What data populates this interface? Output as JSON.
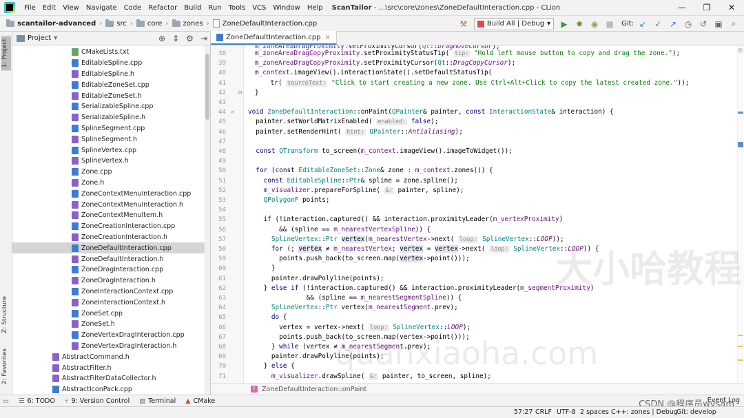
{
  "menubar": {
    "items": [
      "File",
      "Edit",
      "View",
      "Navigate",
      "Code",
      "Refactor",
      "Build",
      "Run",
      "Tools",
      "VCS",
      "Window",
      "Help"
    ],
    "title_app": "ScanTailor",
    "title_path": " - ...\\src\\core\\zones\\ZoneDefaultInteraction.cpp - CLion",
    "min": "—",
    "max": "❐",
    "close": "✕"
  },
  "navbar": {
    "crumbs": [
      "scantailor-advanced",
      "src",
      "core",
      "zones",
      "ZoneDefaultInteraction.cpp"
    ],
    "run_config": "Build All | Debug",
    "git_label": "Git:"
  },
  "left_stripe": {
    "project_tab": "1: Project",
    "structure_tab": "Z: Structure",
    "favorites_tab": "2: Favorites"
  },
  "project_panel": {
    "title": "Project",
    "files": [
      {
        "name": "CMakeLists.txt",
        "type": "txt",
        "indent": 3
      },
      {
        "name": "EditableSpline.cpp",
        "type": "cpp",
        "indent": 3
      },
      {
        "name": "EditableSpline.h",
        "type": "h",
        "indent": 3
      },
      {
        "name": "EditableZoneSet.cpp",
        "type": "cpp",
        "indent": 3
      },
      {
        "name": "EditableZoneSet.h",
        "type": "h",
        "indent": 3
      },
      {
        "name": "SerializableSpline.cpp",
        "type": "cpp",
        "indent": 3
      },
      {
        "name": "SerializableSpline.h",
        "type": "h",
        "indent": 3
      },
      {
        "name": "SplineSegment.cpp",
        "type": "cpp",
        "indent": 3
      },
      {
        "name": "SplineSegment.h",
        "type": "h",
        "indent": 3
      },
      {
        "name": "SplineVertex.cpp",
        "type": "cpp",
        "indent": 3
      },
      {
        "name": "SplineVertex.h",
        "type": "h",
        "indent": 3
      },
      {
        "name": "Zone.cpp",
        "type": "cpp",
        "indent": 3
      },
      {
        "name": "Zone.h",
        "type": "h",
        "indent": 3
      },
      {
        "name": "ZoneContextMenuInteraction.cpp",
        "type": "cpp",
        "indent": 3
      },
      {
        "name": "ZoneContextMenuInteraction.h",
        "type": "h",
        "indent": 3
      },
      {
        "name": "ZoneContextMenuItem.h",
        "type": "h",
        "indent": 3
      },
      {
        "name": "ZoneCreationInteraction.cpp",
        "type": "cpp",
        "indent": 3
      },
      {
        "name": "ZoneCreationInteraction.h",
        "type": "h",
        "indent": 3
      },
      {
        "name": "ZoneDefaultInteraction.cpp",
        "type": "cpp",
        "indent": 3,
        "selected": true
      },
      {
        "name": "ZoneDefaultInteraction.h",
        "type": "h",
        "indent": 3
      },
      {
        "name": "ZoneDragInteraction.cpp",
        "type": "cpp",
        "indent": 3
      },
      {
        "name": "ZoneDragInteraction.h",
        "type": "h",
        "indent": 3
      },
      {
        "name": "ZoneInteractionContext.cpp",
        "type": "cpp",
        "indent": 3
      },
      {
        "name": "ZoneInteractionContext.h",
        "type": "h",
        "indent": 3
      },
      {
        "name": "ZoneSet.cpp",
        "type": "cpp",
        "indent": 3
      },
      {
        "name": "ZoneSet.h",
        "type": "h",
        "indent": 3
      },
      {
        "name": "ZoneVertexDragInteraction.cpp",
        "type": "cpp",
        "indent": 3
      },
      {
        "name": "ZoneVertexDragInteraction.h",
        "type": "h",
        "indent": 3
      },
      {
        "name": "AbstractCommand.h",
        "type": "h",
        "indent": 2
      },
      {
        "name": "AbstractFilter.h",
        "type": "h",
        "indent": 2
      },
      {
        "name": "AbstractFilterDataCollector.h",
        "type": "h",
        "indent": 2
      },
      {
        "name": "AbstractIconPack.cpp",
        "type": "cpp",
        "indent": 2
      }
    ]
  },
  "editor": {
    "tab_label": "ZoneDefaultInteraction.cpp",
    "tab_close": "×",
    "breadcrumb_fn": "ZoneDefaultInteraction::onPaint",
    "lines": [
      {
        "n": "38",
        "html": "<span class=\"fld\">m_zoneAreaDragCopyProximity</span>.setProximityStatusTip( <span class=\"hint\">tip:</span> <span class=\"str\">\"Hold left mouse button to copy and drag the zone.\"</span>);"
      },
      {
        "n": "39",
        "html": "<span class=\"fld\">m_zoneAreaDragCopyProximity</span>.setProximityCursor(<span class=\"typ\">Qt</span>::<span class=\"cst\">DragCopyCursor</span>);"
      },
      {
        "n": "40",
        "html": "<span class=\"fld\">m_context</span>.imageView().interactionState().setDefaultStatusTip("
      },
      {
        "n": "41",
        "html": "    tr( <span class=\"hint\">sourceText:</span> <span class=\"str\">\"Click to start creating a new zone. Use Ctrl+Alt+Click to copy the latest created zone.\"</span>));"
      },
      {
        "n": "42",
        "html": "}"
      },
      {
        "n": "43",
        "html": ""
      },
      {
        "n": "44",
        "html": "<span class=\"kw\">void</span> <span class=\"typ\">ZoneDefaultInteraction</span>::onPaint(<span class=\"typ\">QPainter</span>&amp; painter, <span class=\"kw\">const</span> <span class=\"typ\">InteractionState</span>&amp; interaction) {"
      },
      {
        "n": "45",
        "html": "  painter.setWorldMatrixEnabled( <span class=\"hint\">enabled:</span> <span class=\"kw\">false</span>);"
      },
      {
        "n": "46",
        "html": "  painter.setRenderHint( <span class=\"hint\">hint:</span> <span class=\"typ\">QPainter</span>::<span class=\"cst\">Antialiasing</span>);"
      },
      {
        "n": "47",
        "html": ""
      },
      {
        "n": "48",
        "html": "  <span class=\"kw\">const</span> <span class=\"typ\">QTransform</span> to_screen(<span class=\"fld\">m_context</span>.imageView().imageToWidget());"
      },
      {
        "n": "49",
        "html": ""
      },
      {
        "n": "50",
        "html": "  <span class=\"kw\">for</span> (<span class=\"kw\">const</span> <span class=\"typ\">EditableZoneSet</span>::<span class=\"typ\">Zone</span>&amp; zone : <span class=\"fld\">m_context</span>.zones()) {"
      },
      {
        "n": "51",
        "html": "    <span class=\"kw\">const</span> <span class=\"typ\">EditableSpline</span>::<span class=\"typ\">Ptr</span>&amp; spline = zone.spline();"
      },
      {
        "n": "52",
        "html": "    <span class=\"fld\">m_visualizer</span>.prepareForSpline( <span class=\"hint\">&amp;:</span> painter, spline);"
      },
      {
        "n": "53",
        "html": "    <span class=\"typ\">QPolygonF</span> points;"
      },
      {
        "n": "54",
        "html": ""
      },
      {
        "n": "55",
        "html": "    <span class=\"kw\">if</span> (!interaction.captured() &amp;&amp; interaction.proximityLeader(<span class=\"fld\">m_vertexProximity</span>)"
      },
      {
        "n": "56",
        "html": "        &amp;&amp; (spline == <span class=\"fld\">m_nearestVertexSpline</span>)) {"
      },
      {
        "n": "57",
        "html": "      <span class=\"typ\">SplineVertex</span>::<span class=\"typ\">Ptr</span> <span class=\"hl\">vertex</span>(<span class=\"fld\">m_nearestVertex</span>-&gt;next( <span class=\"hint\">loop:</span> <span class=\"typ\">SplineVertex</span>::<span class=\"cst\">LOOP</span>));"
      },
      {
        "n": "58",
        "html": "      <span class=\"kw\">for</span> (; <span class=\"hl\">vertex</span> ≠ <span class=\"fld\">m_nearestVertex</span>; <span class=\"hl\">vertex</span> = <span class=\"hl\">vertex</span>-&gt;next( <span class=\"hint\">loop:</span> <span class=\"typ\">SplineVertex</span>::<span class=\"cst\">LOOP</span>)) {"
      },
      {
        "n": "59",
        "html": "        points.push_back(to_screen.map(<span class=\"hl\">vertex</span>-&gt;point()));"
      },
      {
        "n": "60",
        "html": "      }"
      },
      {
        "n": "61",
        "html": "      painter.drawPolyline(points);"
      },
      {
        "n": "62",
        "html": "    } <span class=\"kw\">else if</span> (!interaction.captured() &amp;&amp; interaction.proximityLeader(<span class=\"fld\">m_segmentProximity</span>)"
      },
      {
        "n": "63",
        "html": "               &amp;&amp; (spline == <span class=\"fld\">m_nearestSegmentSpline</span>)) {"
      },
      {
        "n": "64",
        "html": "      <span class=\"typ\">SplineVertex</span>::<span class=\"typ\">Ptr</span> vertex(<span class=\"fld\">m_nearestSegment</span>.prev);"
      },
      {
        "n": "65",
        "html": "      <span class=\"kw\">do</span> {"
      },
      {
        "n": "66",
        "html": "        vertex = vertex-&gt;next( <span class=\"hint\">loop:</span> <span class=\"typ\">SplineVertex</span>::<span class=\"cst\">LOOP</span>);"
      },
      {
        "n": "67",
        "html": "        points.push_back(to_screen.map(vertex-&gt;point()));"
      },
      {
        "n": "68",
        "html": "      } <span class=\"kw\">while</span> (vertex ≠ <span class=\"fld\">m_nearestSegment</span>.prev);"
      },
      {
        "n": "69",
        "html": "      painter.drawPolyline(points);"
      },
      {
        "n": "70",
        "html": "    } <span class=\"kw\">else</span> {"
      },
      {
        "n": "71",
        "html": "      <span class=\"fld\">m_visualizer</span>.drawSpline( <span class=\"hint\">&amp;:</span> painter, to_screen, spline);"
      }
    ],
    "first_line_partial": "<span class=\"fld\">m_zoneAreaDragProximity</span>.setProximityCursor(<span class=\"typ\">Qt</span>::<span class=\"cst\">DragMoveCursor</span>);"
  },
  "bottom_tools": {
    "todo": "6: TODO",
    "vcs": "9: Version Control",
    "terminal": "Terminal",
    "cmake": "CMake"
  },
  "status": {
    "position": "57:27",
    "line_sep": "CRLF",
    "encoding": "UTF-8",
    "indent": "2 spaces",
    "context": "C++: zones | Debug",
    "git": "Git: develop",
    "event_log": "Event Log"
  },
  "watermark": {
    "big": "大小哈教程",
    "url": "quanxiaoha.com",
    "csdn": "CSDN @程序员wysam"
  }
}
